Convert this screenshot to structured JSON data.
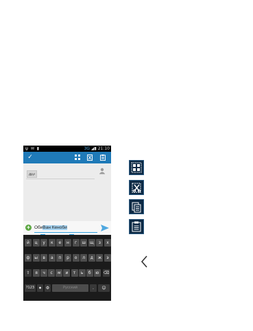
{
  "status_bar": {
    "left_icons": "ψ ✉ ▮",
    "network": "3G",
    "time": "21:10"
  },
  "action_bar": {
    "icons": [
      "check-icon",
      "select-all-icon",
      "cut-icon",
      "paste-icon"
    ]
  },
  "recipient_chip": "Друг",
  "compose": {
    "text_before": "Оби",
    "text_selected": "Ван Кеноби"
  },
  "keyboard": {
    "row1": [
      "й",
      "ц",
      "у",
      "к",
      "е",
      "н",
      "г",
      "ш",
      "щ",
      "з",
      "х"
    ],
    "row2": [
      "ф",
      "ы",
      "в",
      "а",
      "п",
      "р",
      "о",
      "л",
      "д",
      "ж",
      "э"
    ],
    "row3": [
      "я",
      "ч",
      "с",
      "м",
      "и",
      "т",
      "ь",
      "б",
      "ю"
    ],
    "row4": [
      "?123",
      ".",
      "Русский"
    ]
  },
  "side_panel": {
    "icons": [
      "select-all-icon",
      "cut-icon",
      "copy-icon",
      "paste-icon"
    ],
    "back_icon": "chevron-left-icon"
  },
  "colors": {
    "accent": "#1f7ab8",
    "selection": "#33a0dd",
    "keyboard_bg": "#1b1b1b",
    "key": "#4c4c4c"
  }
}
